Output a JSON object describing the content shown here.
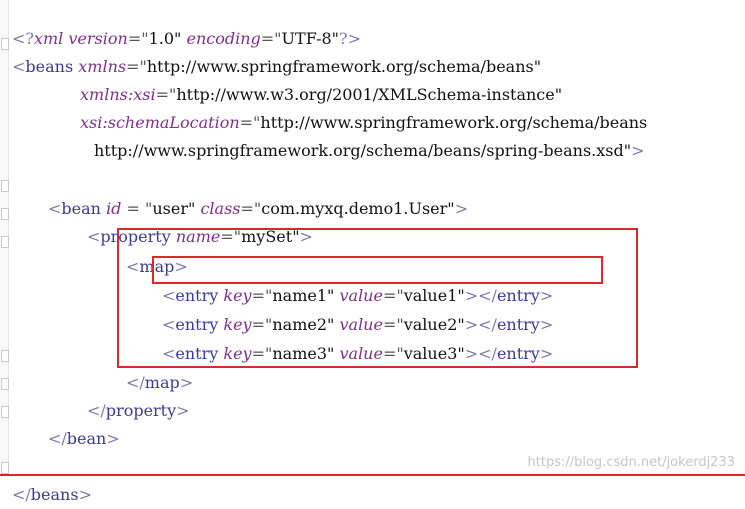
{
  "lines": [
    {
      "pi_open": "<?",
      "pi_name": "xml",
      "a1": "version",
      "v1": "1.0",
      "a2": "encoding",
      "v2": "UTF-8",
      "pi_close": "?>"
    },
    {
      "open": "<",
      "tag": "beans",
      "attr": "xmlns",
      "val": "http://www.springframework.org/schema/beans"
    },
    {
      "attr": "xmlns:xsi",
      "val": "http://www.w3.org/2001/XMLSchema-instance"
    },
    {
      "attr": "xsi:schemaLocation",
      "val": "http://www.springframework.org/schema/beans"
    },
    {
      "val": "http://www.springframework.org/schema/beans/spring-beans.xsd",
      "close": ">"
    },
    {},
    {
      "tag": "bean",
      "a1": "id",
      "v1": "user",
      "a2": "class",
      "v2": "com.myxq.demo1.User"
    },
    {
      "tag": "property",
      "attr": "name",
      "val": "mySet"
    },
    {
      "tag": "map"
    },
    {
      "tag": "entry",
      "a1": "key",
      "v1": "name1",
      "a2": "value",
      "v2": "value1",
      "end": "entry"
    },
    {
      "tag": "entry",
      "a1": "key",
      "v1": "name2",
      "a2": "value",
      "v2": "value2",
      "end": "entry"
    },
    {
      "tag": "entry",
      "a1": "key",
      "v1": "name3",
      "a2": "value",
      "v2": "value3",
      "end": "entry"
    },
    {
      "end": "map"
    },
    {
      "end": "property"
    },
    {
      "end": "bean"
    },
    {},
    {
      "end": "beans"
    }
  ],
  "watermark": "https://blog.csdn.net/jokerdj233"
}
